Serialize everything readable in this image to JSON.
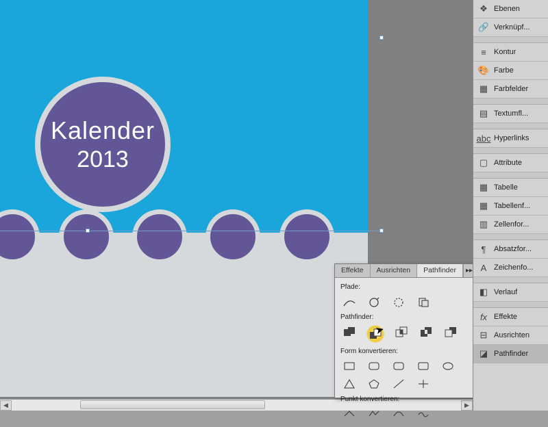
{
  "artboard": {
    "title_line1": "Kalender",
    "title_line2": "2013"
  },
  "sidebar": {
    "items": [
      {
        "label": "Ebenen"
      },
      {
        "label": "Verknüpf..."
      },
      {
        "label": "Kontur"
      },
      {
        "label": "Farbe"
      },
      {
        "label": "Farbfelder"
      },
      {
        "label": "Textumfl..."
      },
      {
        "label": "Hyperlinks"
      },
      {
        "label": "Attribute"
      },
      {
        "label": "Tabelle"
      },
      {
        "label": "Tabellenf..."
      },
      {
        "label": "Zellenfor..."
      },
      {
        "label": "Absatzfor..."
      },
      {
        "label": "Zeichenfo..."
      },
      {
        "label": "Verlauf"
      },
      {
        "label": "Effekte"
      },
      {
        "label": "Ausrichten"
      },
      {
        "label": "Pathfinder"
      }
    ]
  },
  "pathfinder": {
    "tabs": [
      {
        "label": "Effekte"
      },
      {
        "label": "Ausrichten"
      },
      {
        "label": "Pathfinder"
      }
    ],
    "section_paths": "Pfade:",
    "section_pathfinder": "Pathfinder:",
    "section_convert_shape": "Form konvertieren:",
    "section_convert_point": "Punkt konvertieren:"
  }
}
